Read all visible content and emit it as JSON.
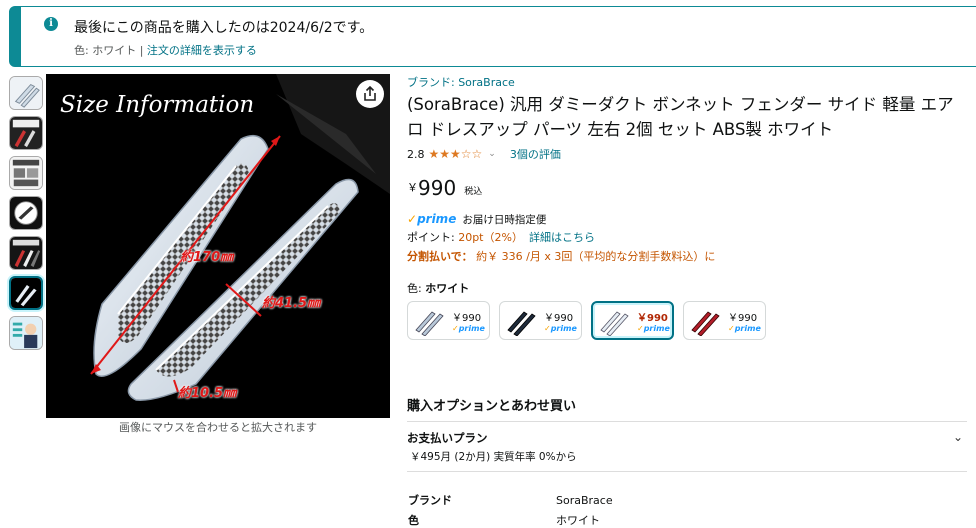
{
  "notice": {
    "title": "最後にこの商品を購入したのは2024/6/2です。",
    "color_prefix": "色: ホワイト | ",
    "details_link": "注文の詳細を表示する"
  },
  "thumbnails": [
    {
      "name": "thumb-1",
      "selected": false
    },
    {
      "name": "thumb-2",
      "selected": false
    },
    {
      "name": "thumb-3",
      "selected": false
    },
    {
      "name": "thumb-4",
      "selected": false
    },
    {
      "name": "thumb-5",
      "selected": false
    },
    {
      "name": "thumb-6",
      "selected": true
    },
    {
      "name": "thumb-7",
      "selected": false
    }
  ],
  "main_image": {
    "heading": "Size Information",
    "dim1": "約170㎜",
    "dim2": "約41.5㎜",
    "dim3": "約10.5㎜",
    "hover_hint": "画像にマウスを合わせると拡大されます"
  },
  "product": {
    "brand_link": "ブランド: SoraBrace",
    "title": "(SoraBrace) 汎用 ダミーダクト ボンネット フェンダー サイド 軽量 エアロ ドレスアップ パーツ 左右 2個 セット ABS製 ホワイト",
    "rating": "2.8",
    "stars": "★★★☆☆",
    "rating_count": "3個の評価",
    "price_symbol": "￥",
    "price": "990",
    "tax": "税込",
    "prime_label": "prime",
    "delivery": "お届け日時指定便",
    "points_label": "ポイント: ",
    "points_value": "20pt（2%）",
    "points_link": "詳細はこちら",
    "installment_label": "分割払いで：",
    "installment_text": " 約￥ 336 /月 x 3回（平均的な分割手数料込）に",
    "color_label": "色: ",
    "color_value": "ホワイト"
  },
  "swatches": [
    {
      "price": "￥990",
      "prime": "prime",
      "color": "#b8c8d8",
      "selected": false
    },
    {
      "price": "￥990",
      "prime": "prime",
      "color": "#1e2a3a",
      "selected": false
    },
    {
      "price": "￥990",
      "prime": "prime",
      "color": "#c8d4e0",
      "selected": true
    },
    {
      "price": "￥990",
      "prime": "prime",
      "color": "#b21e2a",
      "selected": false
    }
  ],
  "options": {
    "heading": "購入オプションとあわせ買い",
    "payment_title": "お支払いプラン",
    "payment_sub": "￥495月 (2か月) 実質年率 0%から"
  },
  "specs": [
    {
      "key": "ブランド",
      "value": "SoraBrace"
    },
    {
      "key": "色",
      "value": "ホワイト"
    }
  ]
}
